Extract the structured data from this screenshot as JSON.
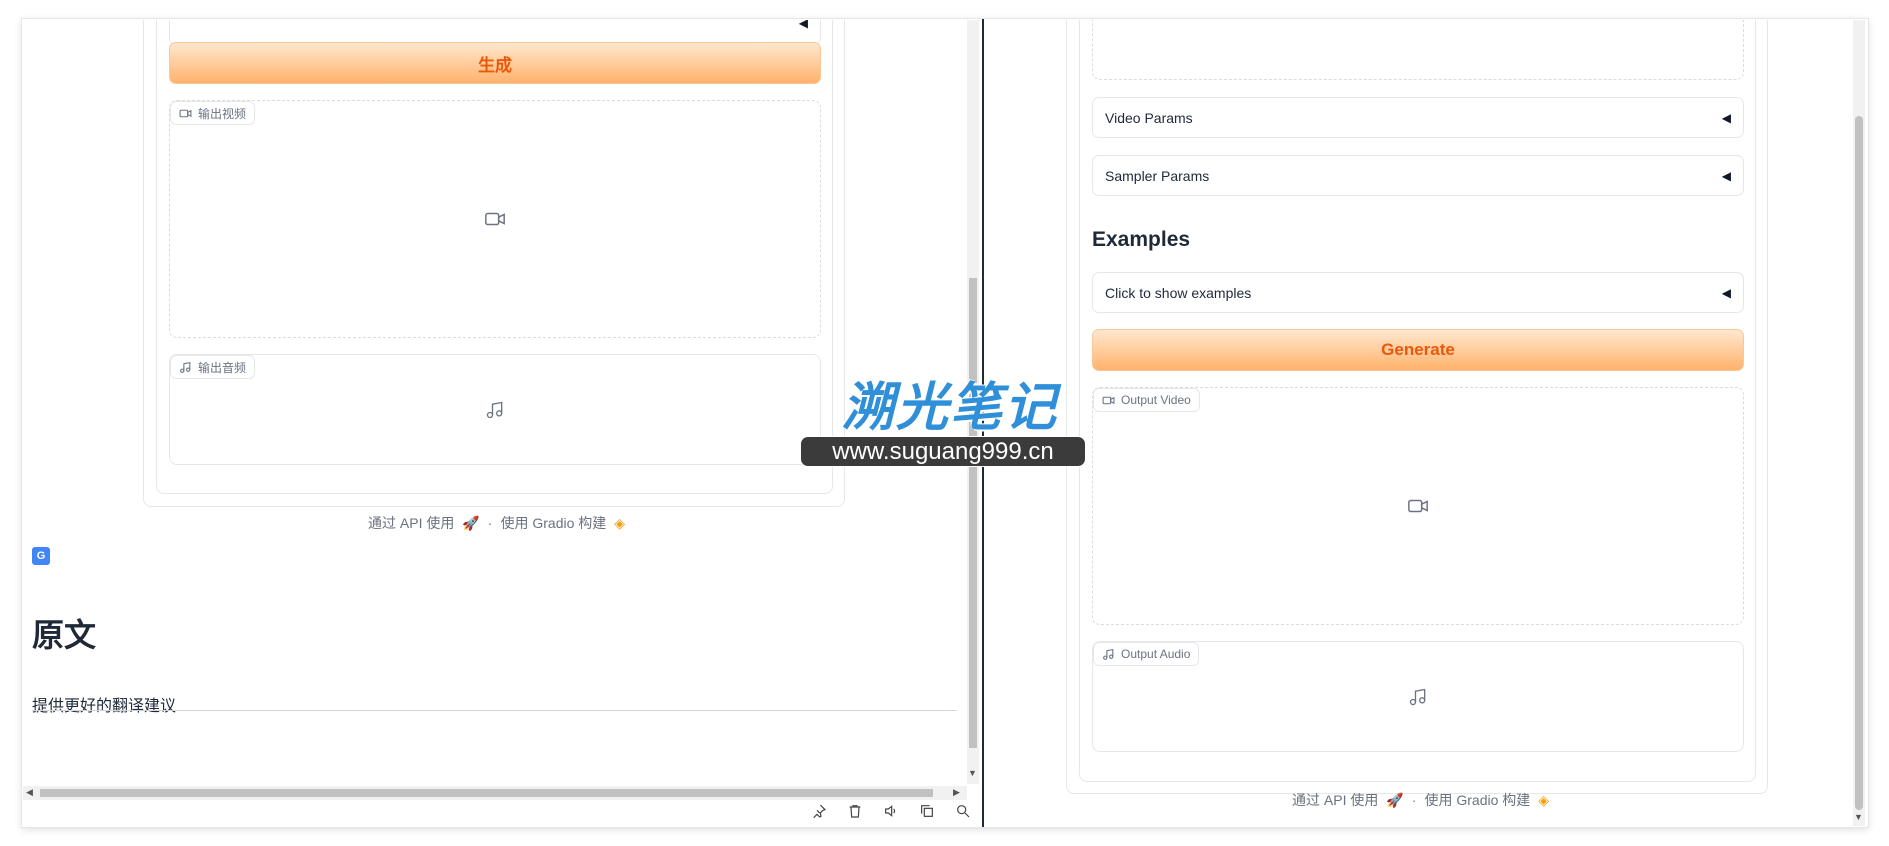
{
  "left": {
    "generate_label": "生成",
    "output_video_label": "输出视频",
    "output_audio_label": "输出音频",
    "footer": {
      "api": "通过 API 使用",
      "sep": "·",
      "built": "使用 Gradio 构建"
    },
    "translate_section": {
      "heading": "原文",
      "suggest_link": "提供更好的翻译建议"
    },
    "toolbar_icons": [
      "pin-icon",
      "trash-icon",
      "speaker-icon",
      "copy-icon",
      "search-icon"
    ]
  },
  "right": {
    "video_params_label": "Video Params",
    "sampler_params_label": "Sampler Params",
    "examples_heading": "Examples",
    "examples_toggle": "Click to show examples",
    "generate_label": "Generate",
    "output_video_label": "Output Video",
    "output_audio_label": "Output Audio",
    "footer": {
      "api": "通过 API 使用",
      "sep": "·",
      "built": "使用 Gradio 构建"
    }
  },
  "watermark": {
    "brand": "溯光笔记",
    "url": "www.suguang999.cn"
  },
  "colors": {
    "accent_orange": "#ea580c",
    "watermark_blue": "#2f8fd8",
    "watermark_green": "#8bc34a"
  }
}
